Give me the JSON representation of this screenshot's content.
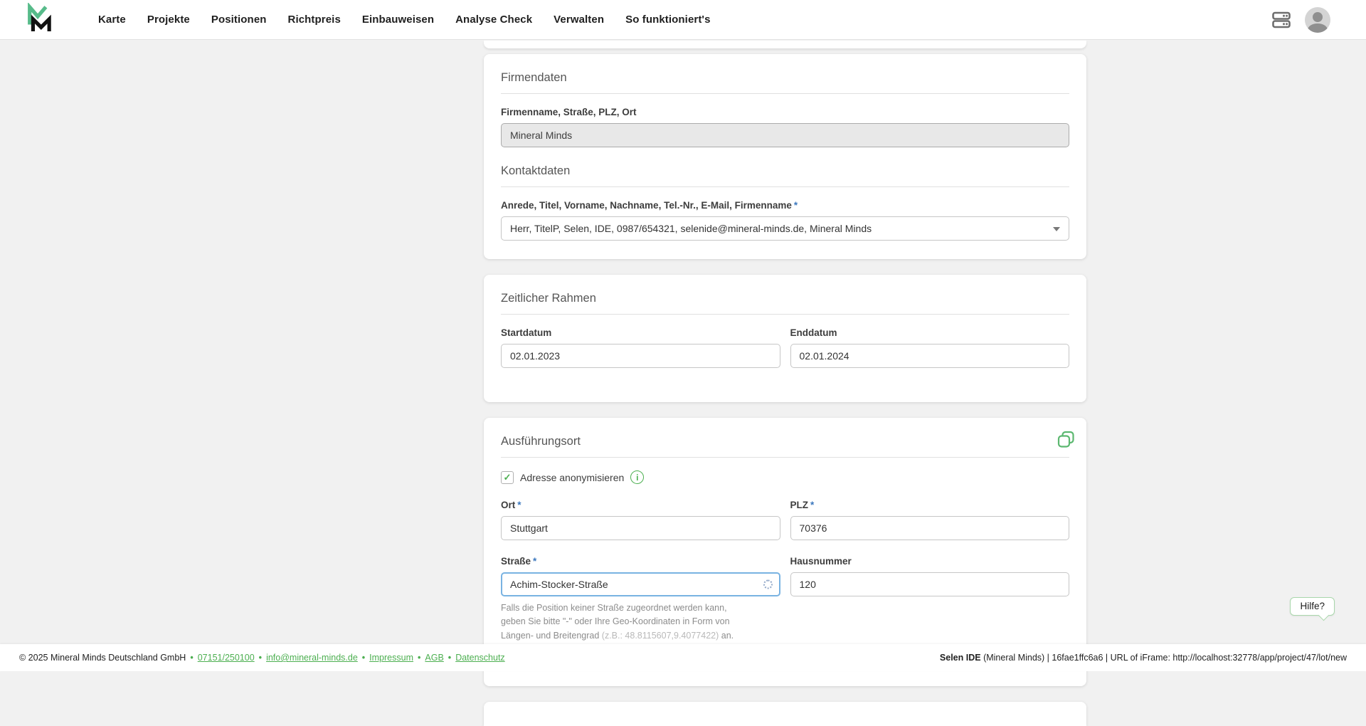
{
  "colors": {
    "accent_green": "#4caf50",
    "logo_green": "#57bb8a",
    "logo_black": "#111111",
    "required_blue": "#3c78be",
    "focus_blue": "#79b3e2",
    "page_background": "#f1f1f1"
  },
  "icons": {
    "check": "✓",
    "info": "i"
  },
  "nav": {
    "items": [
      "Karte",
      "Projekte",
      "Positionen",
      "Richtpreis",
      "Einbauweisen",
      "Analyse Check",
      "Verwalten",
      "So funktioniert's"
    ]
  },
  "form": {
    "required_mark": "*",
    "company": {
      "section_title": "Firmendaten",
      "company_label": "Firmenname, Straße, PLZ, Ort",
      "company_value": "Mineral Minds",
      "contact_section_title": "Kontaktdaten",
      "contact_label": "Anrede, Titel, Vorname, Nachname, Tel.-Nr., E-Mail, Firmenname",
      "contact_value": "Herr, TitelP, Selen, IDE, 0987/654321, selenide@mineral-minds.de, Mineral Minds"
    },
    "timeframe": {
      "section_title": "Zeitlicher Rahmen",
      "start_label": "Startdatum",
      "start_value": "02.01.2023",
      "end_label": "Enddatum",
      "end_value": "02.01.2024"
    },
    "location": {
      "section_title": "Ausführungsort",
      "anonymize_label": "Adresse anonymisieren",
      "ort_label": "Ort",
      "ort_value": "Stuttgart",
      "plz_label": "PLZ",
      "plz_value": "70376",
      "strasse_label": "Straße",
      "strasse_value": "Achim-Stocker-Straße",
      "hausnummer_label": "Hausnummer",
      "hausnummer_value": "120",
      "helper_part1": "Falls die Position keiner Straße zugeordnet werden kann, geben Sie bitte \"-\" oder Ihre Geo-Koordinaten in Form von Längen- und Breitengrad ",
      "helper_hint": "(z.B.: 48.8115607,9.4077422)",
      "helper_part2": " an."
    }
  },
  "help": {
    "label": "Hilfe?"
  },
  "footer": {
    "copyright": "© 2025 Mineral Minds Deutschland GmbH",
    "separator": "•",
    "links": [
      "07151/250100",
      "info@mineral-minds.de",
      "Impressum",
      "AGB",
      "Datenschutz"
    ],
    "right_bold": "Selen IDE",
    "right_rest": " (Mineral Minds) | 16fae1ffc6a6 | URL of iFrame: http://localhost:32778/app/project/47/lot/new"
  }
}
